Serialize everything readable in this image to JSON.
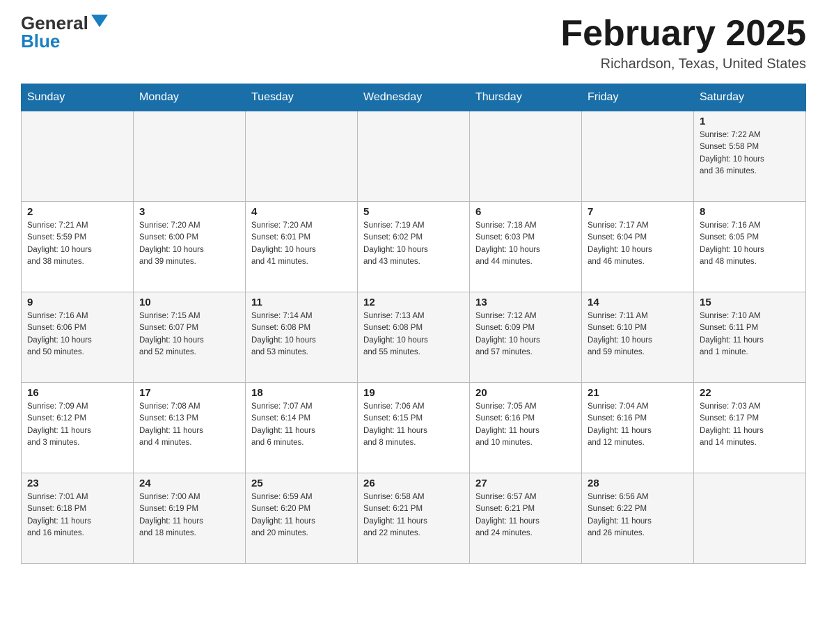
{
  "header": {
    "logo_general": "General",
    "logo_blue": "Blue",
    "month_title": "February 2025",
    "location": "Richardson, Texas, United States"
  },
  "days_of_week": [
    "Sunday",
    "Monday",
    "Tuesday",
    "Wednesday",
    "Thursday",
    "Friday",
    "Saturday"
  ],
  "weeks": [
    [
      {
        "day": "",
        "info": ""
      },
      {
        "day": "",
        "info": ""
      },
      {
        "day": "",
        "info": ""
      },
      {
        "day": "",
        "info": ""
      },
      {
        "day": "",
        "info": ""
      },
      {
        "day": "",
        "info": ""
      },
      {
        "day": "1",
        "info": "Sunrise: 7:22 AM\nSunset: 5:58 PM\nDaylight: 10 hours\nand 36 minutes."
      }
    ],
    [
      {
        "day": "2",
        "info": "Sunrise: 7:21 AM\nSunset: 5:59 PM\nDaylight: 10 hours\nand 38 minutes."
      },
      {
        "day": "3",
        "info": "Sunrise: 7:20 AM\nSunset: 6:00 PM\nDaylight: 10 hours\nand 39 minutes."
      },
      {
        "day": "4",
        "info": "Sunrise: 7:20 AM\nSunset: 6:01 PM\nDaylight: 10 hours\nand 41 minutes."
      },
      {
        "day": "5",
        "info": "Sunrise: 7:19 AM\nSunset: 6:02 PM\nDaylight: 10 hours\nand 43 minutes."
      },
      {
        "day": "6",
        "info": "Sunrise: 7:18 AM\nSunset: 6:03 PM\nDaylight: 10 hours\nand 44 minutes."
      },
      {
        "day": "7",
        "info": "Sunrise: 7:17 AM\nSunset: 6:04 PM\nDaylight: 10 hours\nand 46 minutes."
      },
      {
        "day": "8",
        "info": "Sunrise: 7:16 AM\nSunset: 6:05 PM\nDaylight: 10 hours\nand 48 minutes."
      }
    ],
    [
      {
        "day": "9",
        "info": "Sunrise: 7:16 AM\nSunset: 6:06 PM\nDaylight: 10 hours\nand 50 minutes."
      },
      {
        "day": "10",
        "info": "Sunrise: 7:15 AM\nSunset: 6:07 PM\nDaylight: 10 hours\nand 52 minutes."
      },
      {
        "day": "11",
        "info": "Sunrise: 7:14 AM\nSunset: 6:08 PM\nDaylight: 10 hours\nand 53 minutes."
      },
      {
        "day": "12",
        "info": "Sunrise: 7:13 AM\nSunset: 6:08 PM\nDaylight: 10 hours\nand 55 minutes."
      },
      {
        "day": "13",
        "info": "Sunrise: 7:12 AM\nSunset: 6:09 PM\nDaylight: 10 hours\nand 57 minutes."
      },
      {
        "day": "14",
        "info": "Sunrise: 7:11 AM\nSunset: 6:10 PM\nDaylight: 10 hours\nand 59 minutes."
      },
      {
        "day": "15",
        "info": "Sunrise: 7:10 AM\nSunset: 6:11 PM\nDaylight: 11 hours\nand 1 minute."
      }
    ],
    [
      {
        "day": "16",
        "info": "Sunrise: 7:09 AM\nSunset: 6:12 PM\nDaylight: 11 hours\nand 3 minutes."
      },
      {
        "day": "17",
        "info": "Sunrise: 7:08 AM\nSunset: 6:13 PM\nDaylight: 11 hours\nand 4 minutes."
      },
      {
        "day": "18",
        "info": "Sunrise: 7:07 AM\nSunset: 6:14 PM\nDaylight: 11 hours\nand 6 minutes."
      },
      {
        "day": "19",
        "info": "Sunrise: 7:06 AM\nSunset: 6:15 PM\nDaylight: 11 hours\nand 8 minutes."
      },
      {
        "day": "20",
        "info": "Sunrise: 7:05 AM\nSunset: 6:16 PM\nDaylight: 11 hours\nand 10 minutes."
      },
      {
        "day": "21",
        "info": "Sunrise: 7:04 AM\nSunset: 6:16 PM\nDaylight: 11 hours\nand 12 minutes."
      },
      {
        "day": "22",
        "info": "Sunrise: 7:03 AM\nSunset: 6:17 PM\nDaylight: 11 hours\nand 14 minutes."
      }
    ],
    [
      {
        "day": "23",
        "info": "Sunrise: 7:01 AM\nSunset: 6:18 PM\nDaylight: 11 hours\nand 16 minutes."
      },
      {
        "day": "24",
        "info": "Sunrise: 7:00 AM\nSunset: 6:19 PM\nDaylight: 11 hours\nand 18 minutes."
      },
      {
        "day": "25",
        "info": "Sunrise: 6:59 AM\nSunset: 6:20 PM\nDaylight: 11 hours\nand 20 minutes."
      },
      {
        "day": "26",
        "info": "Sunrise: 6:58 AM\nSunset: 6:21 PM\nDaylight: 11 hours\nand 22 minutes."
      },
      {
        "day": "27",
        "info": "Sunrise: 6:57 AM\nSunset: 6:21 PM\nDaylight: 11 hours\nand 24 minutes."
      },
      {
        "day": "28",
        "info": "Sunrise: 6:56 AM\nSunset: 6:22 PM\nDaylight: 11 hours\nand 26 minutes."
      },
      {
        "day": "",
        "info": ""
      }
    ]
  ]
}
